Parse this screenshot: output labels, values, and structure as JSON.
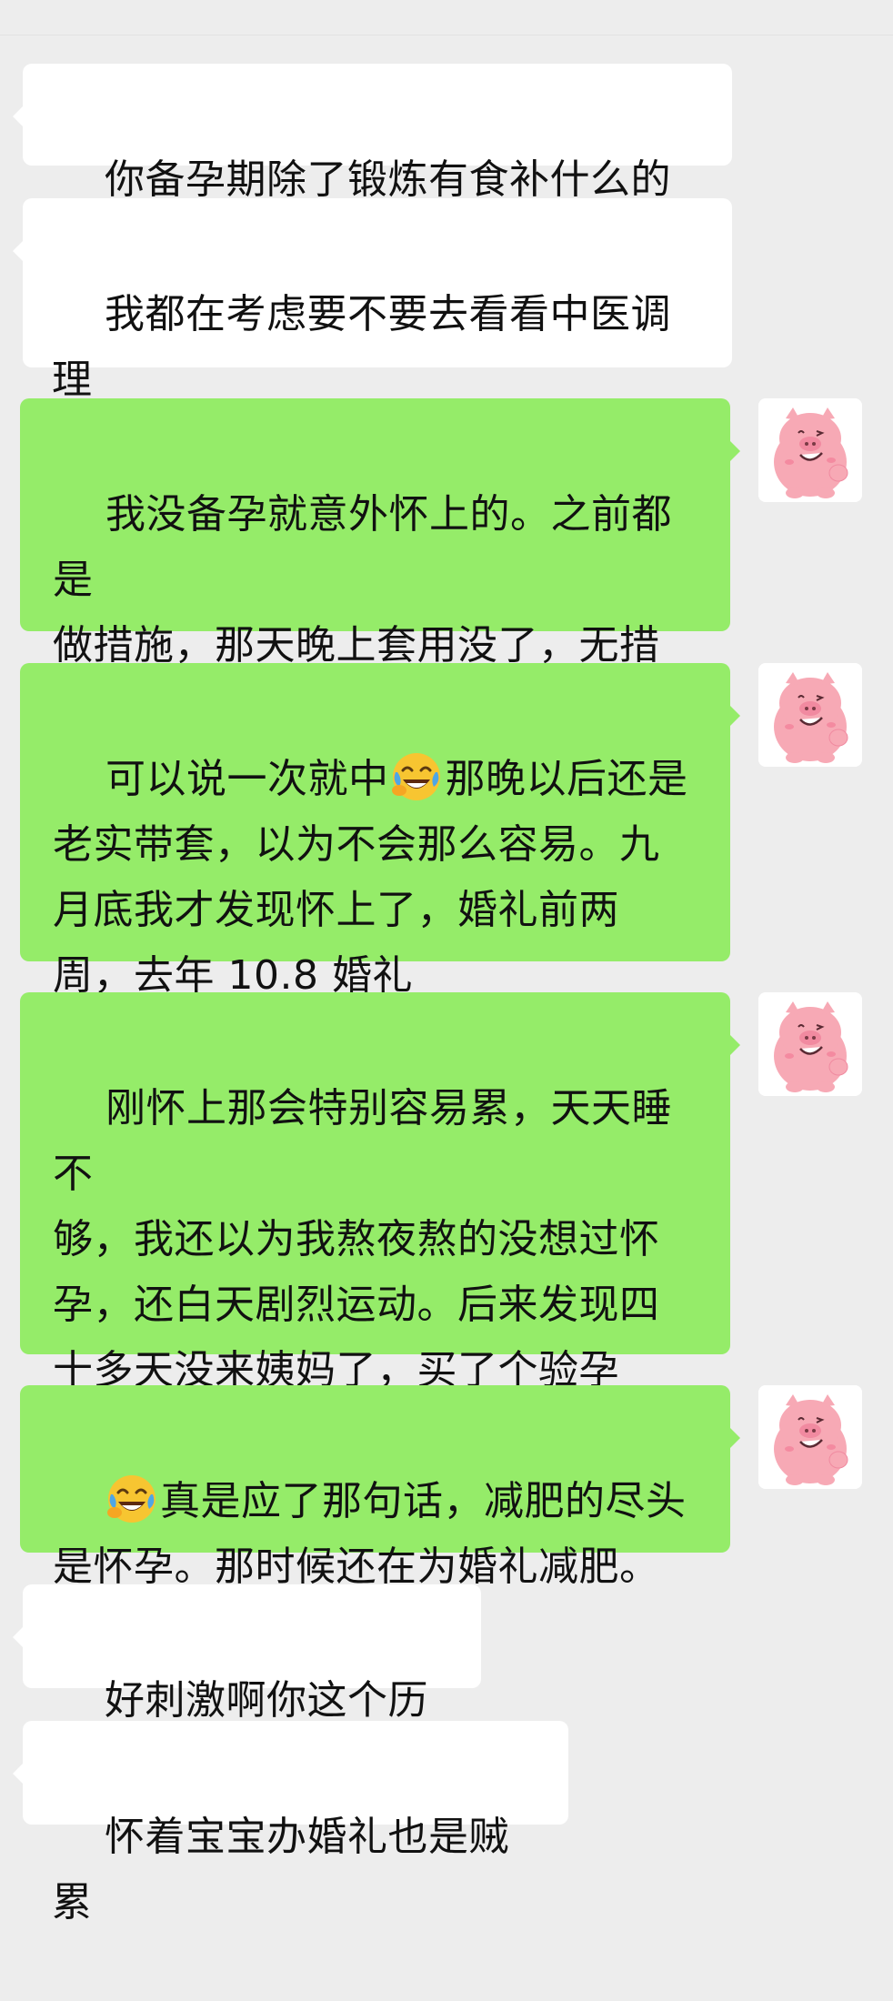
{
  "chat": {
    "messages": [
      {
        "side": "left",
        "text": "你备孕期除了锻炼有食补什么的吗"
      },
      {
        "side": "left",
        "text": "我都在考虑要不要去看看中医调理\n一下身体了"
      },
      {
        "side": "right",
        "text": "我没备孕就意外怀上的。之前都是\n做措施，那天晚上套用没了，无措\n施就怀上了..."
      },
      {
        "side": "right",
        "text_before": "可以说一次就中",
        "emoji": "laughing-crying-emoji",
        "text_after": "那晚以后还是\n老实带套，以为不会那么容易。九\n月底我才发现怀上了，婚礼前两\n周，去年 10.8 婚礼"
      },
      {
        "side": "right",
        "text": "刚怀上那会特别容易累，天天睡不\n够，我还以为我熬夜熬的没想过怀\n孕，还白天剧烈运动。后来发现四\n十多天没来姨妈了，买了个验孕\n棒，发现中奖了"
      },
      {
        "side": "right",
        "emoji": "laughing-crying-emoji",
        "text_after": "真是应了那句话，减肥的尽头\n是怀孕。那时候还在为婚礼减肥。"
      },
      {
        "side": "left",
        "text": "好刺激啊你这个历程"
      },
      {
        "side": "left",
        "text": "怀着宝宝办婚礼也是贼累"
      }
    ],
    "avatar_icon": "pink-pig-avatar-icon"
  },
  "colors": {
    "background": "#ededed",
    "incoming_bubble": "#ffffff",
    "outgoing_bubble": "#95ec69",
    "text": "#111111",
    "pig_pink": "#f7a9b5"
  }
}
